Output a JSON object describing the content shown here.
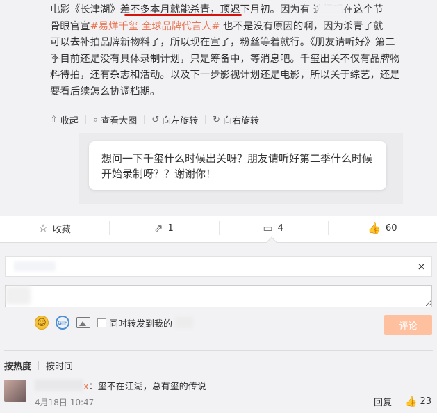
{
  "post": {
    "lines": [
      [
        {
          "t": "电影《长津湖》"
        },
        {
          "t": "差不多本月就能杀青，"
        },
        {
          "t": "顶迟下月初。因为有"
        },
        {
          "t": "     "
        },
        {
          "t": "选择现在这个节"
        }
      ],
      [
        {
          "t": "骨眼官宣"
        },
        {
          "t": "#易烊千玺",
          "hl": true
        },
        {
          "t": "          "
        },
        {
          "t": "全球品牌代言人#",
          "hl": true
        },
        {
          "t": " 也不是没有原因的啊，因为杀青了就"
        }
      ],
      [
        {
          "t": "可以去补拍品牌新物料了，所以现在宣了，粉丝等着就行。《朋友请听好》第二"
        }
      ],
      [
        {
          "t": "季目前还是没有具体录制计划，只是筹备中，等消息吧。千玺出关不仅有品牌物"
        }
      ],
      [
        {
          "t": "料待拍，还有杂志和活动。以及下一步影视计划还是电影，所以关于综艺，还是"
        }
      ],
      [
        {
          "t": "要看后续怎么协调档期。"
        }
      ]
    ]
  },
  "media_tools": [
    {
      "icon": "collapse-icon",
      "glyph": "⇧",
      "label": "收起"
    },
    {
      "icon": "magnifier-icon",
      "glyph": "⌕",
      "label": "查看大图"
    },
    {
      "icon": "rotate-left-icon",
      "glyph": "↺",
      "label": "向左旋转"
    },
    {
      "icon": "rotate-right-icon",
      "glyph": "↻",
      "label": "向右旋转"
    }
  ],
  "image_question": "想问一下千玺什么时候出关呀？朋友请听好第二季什么时候开始录制呀？？谢谢你！",
  "actions": {
    "favorite": {
      "icon": "star-icon",
      "glyph": "☆",
      "label": "收藏"
    },
    "repost": {
      "icon": "share-icon",
      "glyph": "⇗",
      "count": "1"
    },
    "comment": {
      "icon": "comment-icon",
      "glyph": "▭",
      "count": "4"
    },
    "like": {
      "icon": "thumbs-up-icon",
      "glyph": "👍",
      "count": "60"
    }
  },
  "notice": {
    "close_glyph": "×"
  },
  "composer": {
    "input_value": "",
    "forward_label": "同时转发到我的",
    "submit_label": "评论",
    "emoji_glyph": "☺",
    "gif_label": "GIF"
  },
  "sort": {
    "hot": "按热度",
    "time": "按时间"
  },
  "comment": {
    "user_suffix": "x",
    "text": "：玺不在江湖，总有玺的传说",
    "time": "4月18日 10:47",
    "reply": "回复",
    "like_count": "23"
  },
  "colors": {
    "accent": "#eb7350",
    "underline": "#d2140f",
    "submit_bg": "#ffc09f"
  }
}
